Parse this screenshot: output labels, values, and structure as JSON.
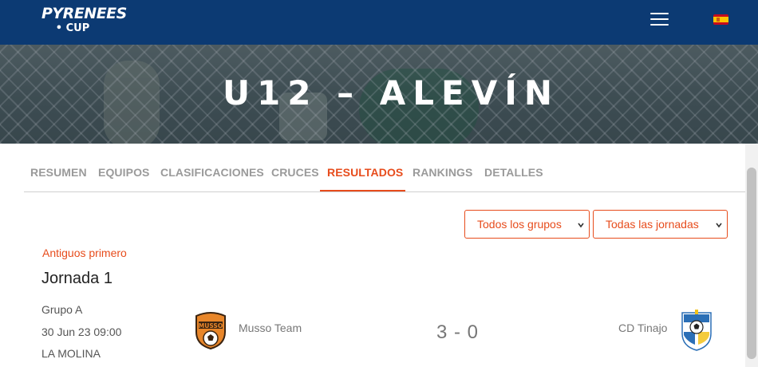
{
  "brand": {
    "line1": "PYRENEES",
    "line2": "• CUP"
  },
  "nav": {
    "menu_icon": "hamburger-menu-icon",
    "language_icon": "spain-flag-icon"
  },
  "hero": {
    "title": "U12 – ALEVÍN"
  },
  "tabs": [
    {
      "label": "RESUMEN",
      "active": false
    },
    {
      "label": "EQUIPOS",
      "active": false
    },
    {
      "label": "CLASIFICACIONES",
      "active": false
    },
    {
      "label": "CRUCES",
      "active": false
    },
    {
      "label": "RESULTADOS",
      "active": true
    },
    {
      "label": "RANKINGS",
      "active": false
    },
    {
      "label": "DETALLES",
      "active": false
    }
  ],
  "filters": {
    "groups": {
      "selected": "Todos los grupos"
    },
    "rounds": {
      "selected": "Todas las jornadas"
    }
  },
  "sort_label": "Antiguos primero",
  "round_title": "Jornada 1",
  "matches": [
    {
      "group": "Grupo A",
      "datetime": "30 Jun 23 09:00",
      "venue": "LA MOLINA",
      "home": {
        "name": "Musso Team",
        "logo_text": "MUSSO"
      },
      "score": "3 - 0",
      "away": {
        "name": "CD Tinajo"
      }
    }
  ],
  "colors": {
    "navbar": "#0c3a73",
    "accent": "#e74c1c"
  }
}
